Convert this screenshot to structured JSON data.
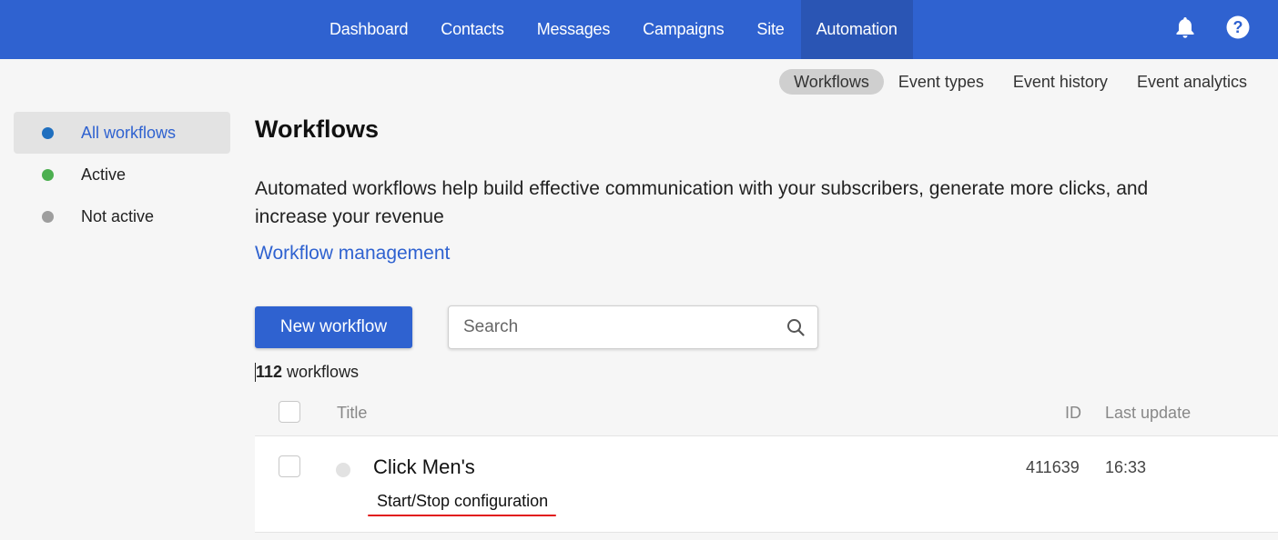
{
  "topnav": {
    "items": [
      {
        "label": "Dashboard"
      },
      {
        "label": "Contacts"
      },
      {
        "label": "Messages"
      },
      {
        "label": "Campaigns"
      },
      {
        "label": "Site"
      },
      {
        "label": "Automation",
        "active": true
      }
    ],
    "icons": [
      "bell-icon",
      "help-icon"
    ],
    "accent_color": "#2f62d0"
  },
  "subnav": {
    "items": [
      {
        "label": "Workflows",
        "active": true
      },
      {
        "label": "Event types"
      },
      {
        "label": "Event history"
      },
      {
        "label": "Event analytics"
      }
    ]
  },
  "sidebar": {
    "items": [
      {
        "label": "All workflows",
        "color": "#1f6fbf",
        "active": true
      },
      {
        "label": "Active",
        "color": "#4caf50"
      },
      {
        "label": "Not active",
        "color": "#9e9e9e"
      }
    ]
  },
  "main": {
    "title": "Workflows",
    "description": "Automated workflows help build effective communication with your subscribers, generate more clicks, and increase your revenue",
    "management_link": "Workflow management",
    "new_button": "New workflow",
    "search_placeholder": "Search",
    "count_number": "112",
    "count_label": " workflows"
  },
  "table": {
    "columns": {
      "title": "Title",
      "id": "ID",
      "last_update": "Last update"
    },
    "rows": [
      {
        "title": "Click Men's",
        "subtitle": "Start/Stop configuration",
        "id": "411639",
        "last_update": "16:33",
        "status": "inactive"
      }
    ]
  }
}
